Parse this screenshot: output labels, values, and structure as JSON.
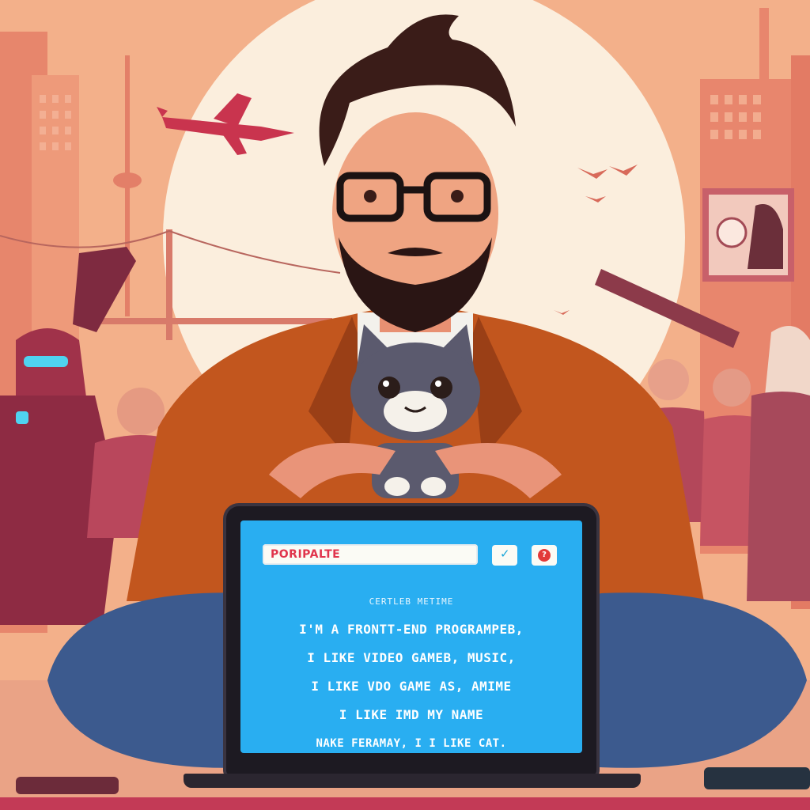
{
  "laptop": {
    "address_bar": "PORIPALTE",
    "button_a_glyph": "✓",
    "button_b_glyph": "?",
    "subtitle": "CERTLEB METIME",
    "lines": [
      "I'M A FRONTT-END PROGRAMPEB,",
      "I LIKE VIDEO GAMEB, MUSIC,",
      "I LIKE VDO GAME AS, AMIME",
      "I LIKE IMD MY NAME",
      "NAKE FERAMAY, I I LIKE CAT."
    ]
  },
  "colors": {
    "sky": "#f3b08a",
    "sun": "#fbeedd",
    "screen": "#29aef1",
    "jacket": "#c2561e",
    "jeans": "#3c5a8e",
    "accent_red": "#e0344c"
  }
}
